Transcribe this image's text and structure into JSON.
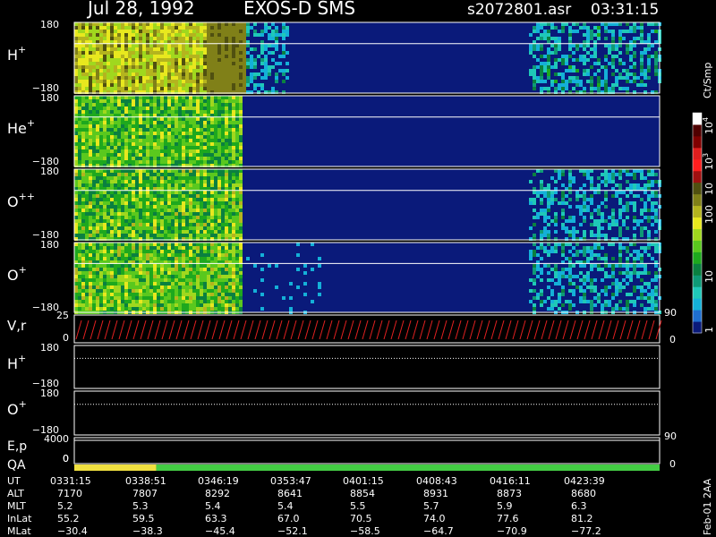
{
  "header": {
    "date": "Jul 28, 1992",
    "instrument": "EXOS-D SMS",
    "file": "s2072801.asr",
    "time": "03:31:15"
  },
  "side_label": "Feb-01  2AA",
  "colorbar": {
    "title": "Ct/Smp",
    "ticks": [
      "1",
      "10",
      "100",
      "10",
      "10",
      "10"
    ],
    "tick_exponents": [
      "",
      "",
      "",
      "",
      "3",
      "4"
    ],
    "colors": [
      "#0a1a7a",
      "#1f6fd0",
      "#14b0d8",
      "#1fc8b8",
      "#0e9a76",
      "#0a8040",
      "#1ea81e",
      "#5ac81e",
      "#a0d81e",
      "#e8e81e",
      "#b4b41e",
      "#808018",
      "#505010",
      "#a01010",
      "#ff1e1e",
      "#e01e1e",
      "#800000",
      "#500000",
      "#ffffff"
    ]
  },
  "chart_data": [
    {
      "type": "heatmap",
      "name_label": "H",
      "superscript": "+",
      "ylim": [
        -180,
        180
      ],
      "tick_labels": [
        "180",
        "−180"
      ],
      "color_scale": "log",
      "crange": [
        1,
        10000
      ],
      "description_hint": ""
    },
    {
      "type": "heatmap",
      "name_label": "He",
      "superscript": "+",
      "ylim": [
        -180,
        180
      ],
      "tick_labels": [
        "180",
        "−180"
      ]
    },
    {
      "type": "heatmap",
      "name_label": "O",
      "superscript": "++",
      "ylim": [
        -180,
        180
      ],
      "tick_labels": [
        "180",
        "−180"
      ]
    },
    {
      "type": "heatmap",
      "name_label": "O",
      "superscript": "+",
      "ylim": [
        -180,
        180
      ],
      "tick_labels": [
        "180",
        "−180"
      ]
    },
    {
      "type": "line",
      "name_label": "V,r",
      "left_ticks": [
        "25",
        "0"
      ],
      "right_ticks": [
        "90",
        "0"
      ],
      "ylim": [
        0,
        25
      ]
    },
    {
      "type": "line",
      "name_label": "H",
      "superscript": "+",
      "tick_labels": [
        "180",
        "−180"
      ],
      "ylim": [
        -180,
        180
      ]
    },
    {
      "type": "line",
      "name_label": "O",
      "superscript": "+",
      "tick_labels": [
        "180",
        "−180"
      ],
      "ylim": [
        -180,
        180
      ]
    },
    {
      "type": "line",
      "name_label": "E,p",
      "left_ticks": [
        "4000",
        "0"
      ],
      "right_ticks": [
        "90"
      ]
    },
    {
      "type": "bar",
      "name_label": "QA",
      "left_ticks": [
        "0"
      ],
      "right_ticks": [
        "0"
      ],
      "segments": [
        {
          "color": "#f0e040",
          "fraction": 0.14
        },
        {
          "color": "#44cc44",
          "fraction": 0.86
        }
      ]
    }
  ],
  "ephemeris": {
    "row_labels": [
      "UT",
      "ALT",
      "MLT",
      "InLat",
      "MLat"
    ],
    "columns": [
      {
        "UT": "0331:15",
        "ALT": "7170",
        "MLT": "5.2",
        "InLat": "55.2",
        "MLat": "−30.4"
      },
      {
        "UT": "0338:51",
        "ALT": "7807",
        "MLT": "5.3",
        "InLat": "59.5",
        "MLat": "−38.3"
      },
      {
        "UT": "0346:19",
        "ALT": "8292",
        "MLT": "5.4",
        "InLat": "63.3",
        "MLat": "−45.4"
      },
      {
        "UT": "0353:47",
        "ALT": "8641",
        "MLT": "5.4",
        "InLat": "67.0",
        "MLat": "−52.1"
      },
      {
        "UT": "0401:15",
        "ALT": "8854",
        "MLT": "5.5",
        "InLat": "70.5",
        "MLat": "−58.5"
      },
      {
        "UT": "0408:43",
        "ALT": "8931",
        "MLT": "5.7",
        "InLat": "74.0",
        "MLat": "−64.7"
      },
      {
        "UT": "0416:11",
        "ALT": "8873",
        "MLT": "5.9",
        "InLat": "77.6",
        "MLat": "−70.9"
      },
      {
        "UT": "0423:39",
        "ALT": "8680",
        "MLT": "6.3",
        "InLat": "81.2",
        "MLat": "−77.2"
      }
    ]
  }
}
